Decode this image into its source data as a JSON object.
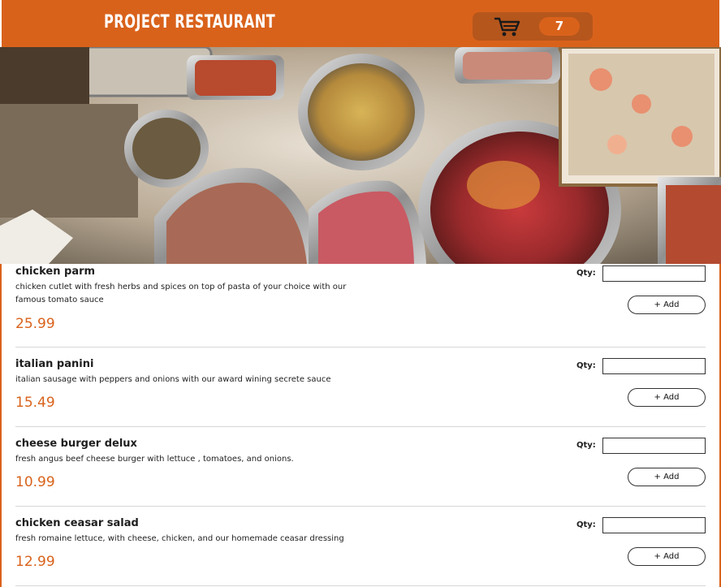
{
  "header": {
    "brand": "PROJECT RESTAURANT",
    "cart_count": "7",
    "accent_color": "#d9621b"
  },
  "hero": {
    "alt": "banquet buffet spread"
  },
  "menu": {
    "qty_label": "Qty:",
    "add_label": "+ Add",
    "items": [
      {
        "name": "chicken parm",
        "description": "chicken cutlet with fresh herbs and spices on top of pasta of your choice with our famous tomato sauce",
        "price": "25.99"
      },
      {
        "name": "italian panini",
        "description": "italian sausage with peppers and onions with our award wining secrete sauce",
        "price": "15.49"
      },
      {
        "name": "cheese burger delux",
        "description": "fresh angus beef cheese burger with lettuce , tomatoes, and onions.",
        "price": "10.99"
      },
      {
        "name": "chicken ceasar salad",
        "description": "fresh romaine lettuce, with cheese, chicken, and our homemade ceasar dressing",
        "price": "12.99"
      }
    ]
  }
}
